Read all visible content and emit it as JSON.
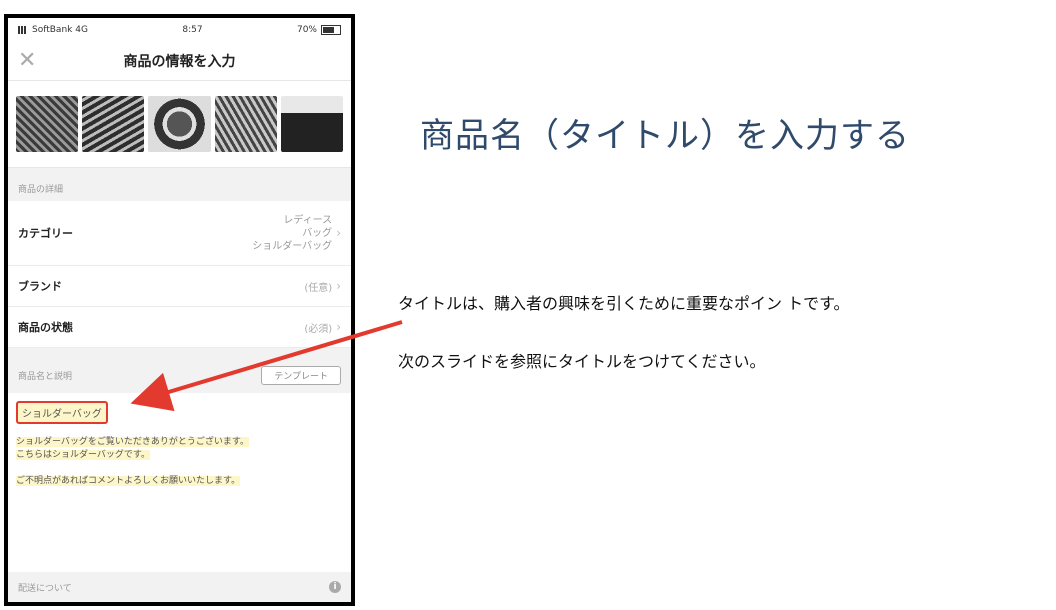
{
  "status_bar": {
    "carrier": "SoftBank 4G",
    "time": "8:57",
    "battery": "70%"
  },
  "nav": {
    "title": "商品の情報を入力",
    "close_icon": "close-x-icon"
  },
  "photos": [
    "bag-photo-1",
    "bag-photo-2",
    "bag-photo-3",
    "bag-photo-4",
    "bag-photo-5"
  ],
  "details": {
    "section_label": "商品の詳細",
    "category": {
      "label": "カテゴリー",
      "value_lines": [
        "レディース",
        "バッグ",
        "ショルダーバッグ"
      ]
    },
    "brand": {
      "label": "ブランド",
      "value": "(任意)"
    },
    "condition": {
      "label": "商品の状態",
      "value": "(必須)"
    }
  },
  "description": {
    "section_label": "商品名と説明",
    "template_button": "テンプレート",
    "title_value": "ショルダーバッグ",
    "body_line1": "ショルダーバッグをご覧いただきありがとうございます。",
    "body_line2": "こちらはショルダーバッグです。",
    "body_line3": "ご不明点があればコメントよろしくお願いいたします。"
  },
  "shipping": {
    "label": "配送について"
  },
  "slide": {
    "title": "商品名（タイトル）を入力する",
    "note1": "タイトルは、購入者の興味を引くために重要なポイン トです。",
    "note2": "次のスライドを参照にタイトルをつけてください。"
  },
  "colors": {
    "highlight_border": "#e23a2e",
    "title_color": "#2f4a6b",
    "text_highlight": "#fdf6c8"
  }
}
